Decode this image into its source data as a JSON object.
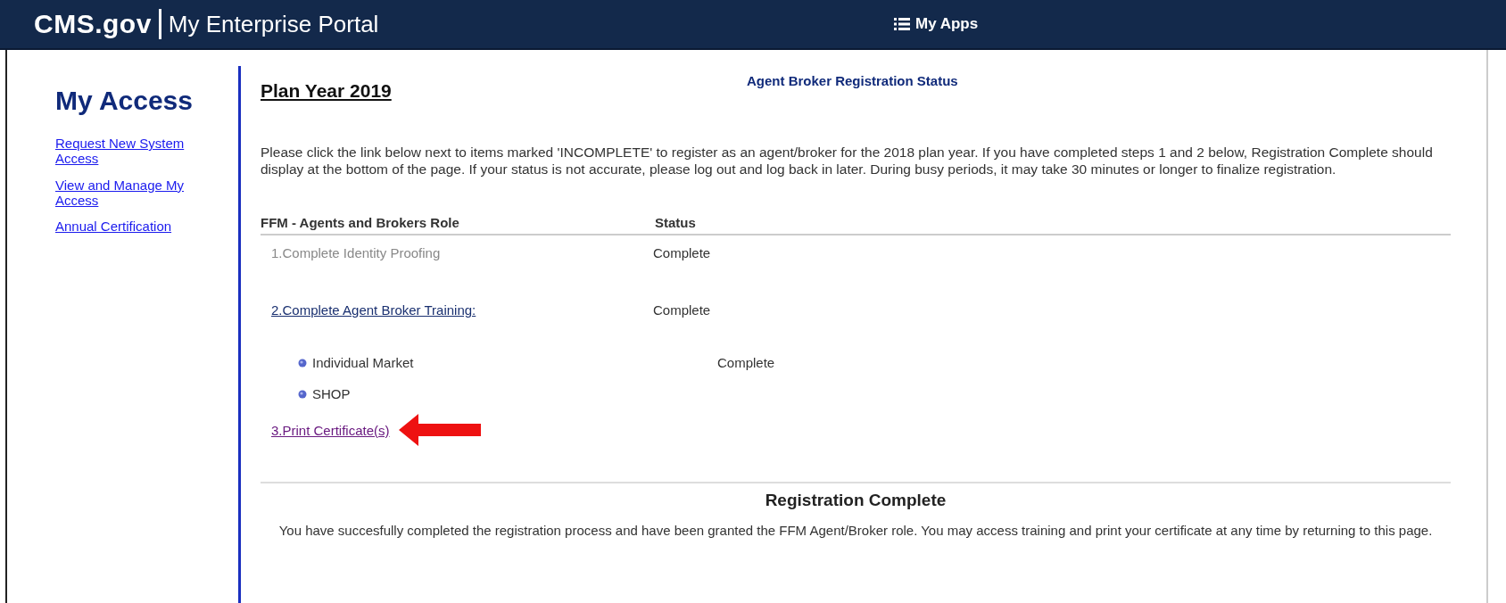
{
  "header": {
    "logo": "CMS.gov",
    "portal_title": "My Enterprise Portal",
    "apps_button": "My Apps"
  },
  "sidebar": {
    "title": "My Access",
    "links": [
      {
        "label": "Request New System Access"
      },
      {
        "label": "View and Manage My Access"
      },
      {
        "label": "Annual Certification"
      }
    ]
  },
  "main": {
    "plan_year": "Plan Year 2019",
    "title": "Agent Broker Registration Status",
    "intro": "Please click the link below next to items marked 'INCOMPLETE' to register as an agent/broker for the 2018 plan year. If you have completed steps 1 and 2 below, Registration Complete should display at the bottom of the page. If your status is not accurate, please log out and log back in later. During busy periods, it may take 30 minutes or longer to finalize registration.",
    "table": {
      "columns": [
        "FFM - Agents and Brokers Role",
        "Status"
      ],
      "rows": [
        {
          "kind": "step",
          "label": "1.Complete Identity Proofing",
          "status": "Complete",
          "disabled": true,
          "visited": false,
          "highlighted": false
        },
        {
          "kind": "step",
          "label": "2.Complete Agent Broker Training:",
          "status": "Complete",
          "disabled": false,
          "visited": false,
          "highlighted": false
        },
        {
          "kind": "sub",
          "label": "Individual Market",
          "status": "Complete"
        },
        {
          "kind": "sub",
          "label": "SHOP"
        },
        {
          "kind": "step",
          "label": "3.Print Certificate(s)",
          "disabled": false,
          "visited": true,
          "highlighted": true
        }
      ]
    },
    "result_title": "Registration Complete",
    "result_text": "You have succesfully completed the registration process and have been granted the FFM Agent/Broker role. You may access training and print your certificate at any time by returning to this page."
  }
}
